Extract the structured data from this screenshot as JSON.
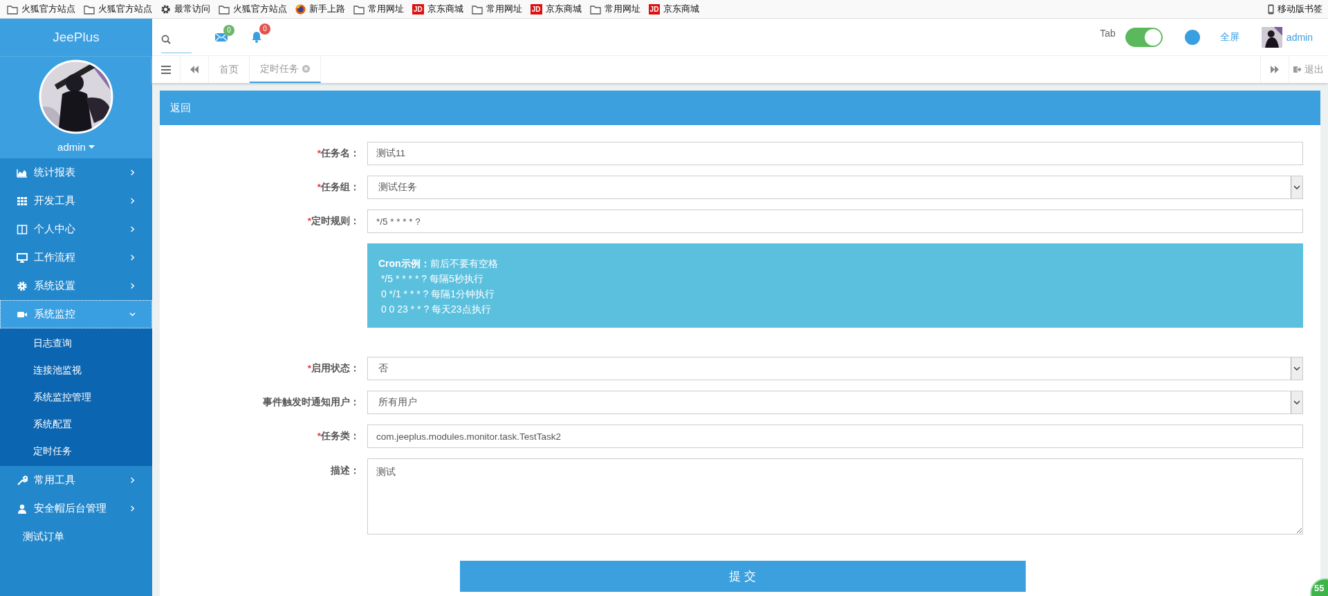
{
  "bookmarks": {
    "items": [
      {
        "kind": "folder",
        "label": "火狐官方站点"
      },
      {
        "kind": "folder",
        "label": "火狐官方站点"
      },
      {
        "kind": "gear",
        "label": "最常访问"
      },
      {
        "kind": "folder",
        "label": "火狐官方站点"
      },
      {
        "kind": "browser",
        "label": "新手上路"
      },
      {
        "kind": "folder",
        "label": "常用网址"
      },
      {
        "kind": "jd",
        "label": "京东商城",
        "mark": "JD"
      },
      {
        "kind": "folder",
        "label": "常用网址"
      },
      {
        "kind": "jd",
        "label": "京东商城",
        "mark": "JD"
      },
      {
        "kind": "folder",
        "label": "常用网址"
      },
      {
        "kind": "jd",
        "label": "京东商城",
        "mark": "JD"
      }
    ],
    "mobile": "移动版书签"
  },
  "sidebar": {
    "brand": "JeePlus",
    "user": "admin",
    "menu": [
      {
        "label": "统计报表",
        "kind": "group",
        "expanded": false,
        "selected": false
      },
      {
        "label": "开发工具",
        "kind": "group",
        "expanded": false,
        "selected": false
      },
      {
        "label": "个人中心",
        "kind": "group",
        "expanded": false,
        "selected": false
      },
      {
        "label": "工作流程",
        "kind": "group",
        "expanded": false,
        "selected": false
      },
      {
        "label": "系统设置",
        "kind": "group",
        "expanded": false,
        "selected": false
      },
      {
        "label": "系统监控",
        "kind": "group",
        "expanded": true,
        "selected": true,
        "children": [
          {
            "label": "日志查询"
          },
          {
            "label": "连接池监视"
          },
          {
            "label": "系统监控管理"
          },
          {
            "label": "系统配置"
          },
          {
            "label": "定时任务"
          }
        ]
      },
      {
        "label": "常用工具",
        "kind": "group",
        "expanded": false,
        "selected": false
      },
      {
        "label": "安全帽后台管理",
        "kind": "group",
        "expanded": false,
        "selected": false
      },
      {
        "label": "测试订单",
        "kind": "link",
        "selected": false
      }
    ]
  },
  "header": {
    "notifications": [
      {
        "kind": "mail",
        "count": "0",
        "color": "#6cb66c"
      },
      {
        "kind": "bell",
        "count": "0",
        "color": "#e5524e"
      }
    ],
    "tab_switch": {
      "label": "Tab",
      "on": true
    },
    "fullscreen": "全屏",
    "user": "admin"
  },
  "tabs": [
    {
      "label": "首页",
      "selected": false,
      "closable": false
    },
    {
      "label": "定时任务",
      "selected": true,
      "closable": true
    }
  ],
  "logout": "退出",
  "panel": {
    "back": "返回",
    "fields": [
      {
        "kind": "text",
        "mark": "*",
        "label": "任务名：",
        "value": "测试11"
      },
      {
        "kind": "select",
        "mark": "*",
        "label": "任务组：",
        "value": "测试任务"
      },
      {
        "kind": "text",
        "mark": "*",
        "label": "定时规则：",
        "value": "*/5 * * * * ?"
      },
      {
        "kind": "info",
        "lines": [
          "**Cron示例：**前后不要有空格",
          " */5 * * * * ? 每隔5秒执行",
          " 0 */1 * * * ? 每隔1分钟执行",
          " 0 0 23 * * ? 每天23点执行"
        ]
      },
      {
        "kind": "select",
        "mark": "*",
        "label": "启用状态：",
        "value": "否"
      },
      {
        "kind": "select",
        "label": "事件触发时通知用户：",
        "value": "所有用户"
      },
      {
        "kind": "text",
        "mark": "*",
        "label": "任务类：",
        "value": "com.jeeplus.modules.monitor.task.TestTask2"
      },
      {
        "kind": "textarea",
        "label": "描述：",
        "value": "测试"
      }
    ],
    "submit": "提 交"
  },
  "corner_badge": "55"
}
